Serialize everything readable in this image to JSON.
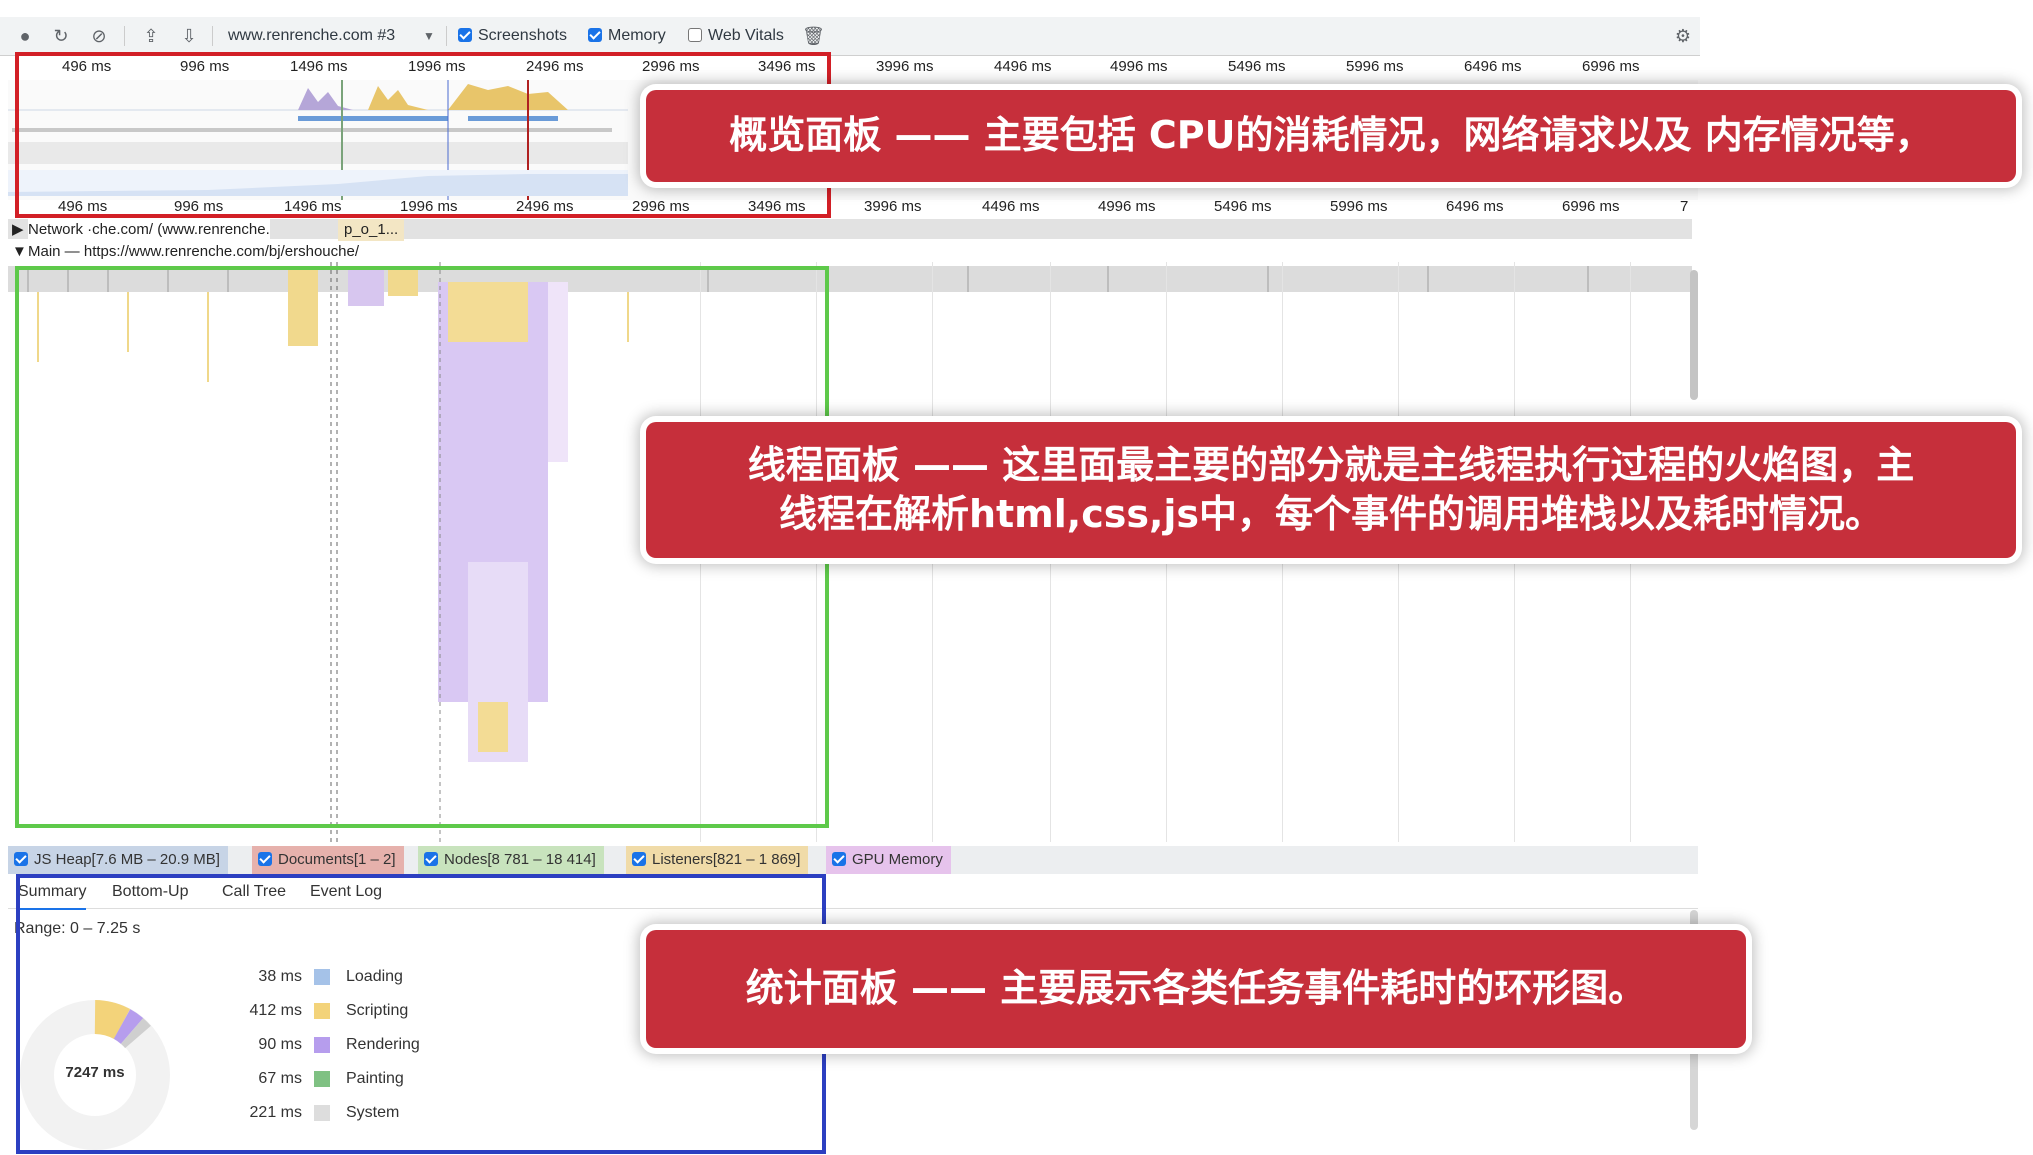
{
  "toolbar": {
    "url": "www.renrenche.com #3",
    "screenshots_label": "Screenshots",
    "memory_label": "Memory",
    "web_vitals_label": "Web Vitals"
  },
  "ruler_top": [
    "496 ms",
    "996 ms",
    "1496 ms",
    "1996 ms",
    "2496 ms",
    "2996 ms",
    "3496 ms",
    "3996 ms",
    "4496 ms",
    "4996 ms",
    "5496 ms",
    "5996 ms",
    "6496 ms",
    "6996 ms"
  ],
  "ruler_bottom": [
    "496 ms",
    "996 ms",
    "1496 ms",
    "1996 ms",
    "2496 ms",
    "2996 ms",
    "3496 ms",
    "3996 ms",
    "4496 ms",
    "4996 ms",
    "5496 ms",
    "5996 ms",
    "6496 ms",
    "6996 ms",
    "7"
  ],
  "tracks": {
    "network": "Network ·che.com/ (www.renrenche.",
    "network_extra": "p_o_1...",
    "main": "Main — https://www.renrenche.com/bj/ershouche/"
  },
  "memory_counters": [
    {
      "label": "JS Heap[7.6 MB – 20.9 MB]",
      "color": "#9fb5d4"
    },
    {
      "label": "Documents[1 – 2]",
      "color": "#d9908a"
    },
    {
      "label": "Nodes[8 781 – 18 414]",
      "color": "#a7d19a"
    },
    {
      "label": "Listeners[821 – 1 869]",
      "color": "#e5c27a"
    },
    {
      "label": "GPU Memory",
      "color": "#d9a6e0"
    }
  ],
  "tabs": [
    "Summary",
    "Bottom-Up",
    "Call Tree",
    "Event Log"
  ],
  "summary": {
    "range": "Range: 0 – 7.25 s",
    "total": "7247 ms",
    "items": [
      {
        "value": "38 ms",
        "label": "Loading",
        "color": "#a5c2e8"
      },
      {
        "value": "412 ms",
        "label": "Scripting",
        "color": "#f3d37a"
      },
      {
        "value": "90 ms",
        "label": "Rendering",
        "color": "#b69ded"
      },
      {
        "value": "67 ms",
        "label": "Painting",
        "color": "#7fc183"
      },
      {
        "value": "221 ms",
        "label": "System",
        "color": "#dddddd"
      }
    ]
  },
  "callouts": {
    "overview": "概览面板 —— 主要包括 CPU的消耗情况，网络请求以及 内存情况等，",
    "threads_line1": "线程面板 —— 这里面最主要的部分就是主线程执行过程的火焰图，主",
    "threads_line2": "线程在解析html,css,js中，每个事件的调用堆栈以及耗时情况。",
    "stats": "统计面板 —— 主要展示各类任务事件耗时的环形图。"
  },
  "colors": {
    "overview_box": "#d21f26",
    "threads_box": "#5ec94a",
    "stats_box": "#2c3fc1",
    "callout_bg": "#c62f3b"
  }
}
